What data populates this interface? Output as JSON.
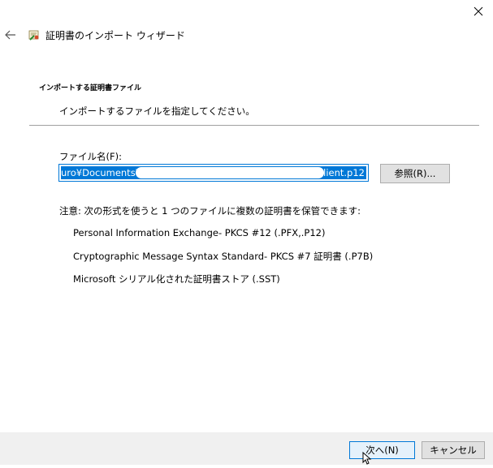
{
  "window": {
    "title": "証明書のインポート ウィザード"
  },
  "section": {
    "title": "インポートする証明書ファイル",
    "subtitle": "インポートするファイルを指定してください。"
  },
  "file": {
    "label": "ファイル名(F):",
    "value_prefix": "uro¥Documents¥",
    "value_suffix": "¥client.p12",
    "browse_label": "参照(R)..."
  },
  "note": {
    "text": "注意: 次の形式を使うと 1 つのファイルに複数の証明書を保管できます:",
    "formats": [
      "Personal Information Exchange- PKCS #12 (.PFX,.P12)",
      "Cryptographic Message Syntax Standard- PKCS #7 証明書 (.P7B)",
      "Microsoft シリアル化された証明書ストア (.SST)"
    ]
  },
  "buttons": {
    "next": "次へ(N)",
    "cancel": "キャンセル"
  },
  "colors": {
    "accent": "#0078d7",
    "footer_bg": "#f0f0f0",
    "button_bg": "#e1e1e1"
  }
}
